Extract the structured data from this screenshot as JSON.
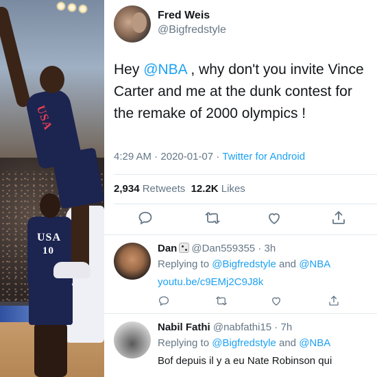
{
  "main_tweet": {
    "author_name": "Fred Weis",
    "author_handle": "@Bigfredstyle",
    "text_parts": {
      "pre": "Hey ",
      "mention": "@NBA",
      "post": " , why don't you invite Vince Carter and me at the dunk contest for the remake of 2000 olympics !"
    },
    "time": "4:29 AM",
    "separator": " · ",
    "date": "2020-01-07",
    "source": "Twitter for Android",
    "retweets_count": "2,934",
    "retweets_label": " Retweets",
    "likes_count": "12.2K",
    "likes_label": " Likes",
    "actions": [
      "reply-icon",
      "retweet-icon",
      "like-icon",
      "share-icon"
    ]
  },
  "photo": {
    "jersey_top": "USA",
    "jersey_bottom": "USA",
    "jersey_number": "10"
  },
  "replies": [
    {
      "name": "Dan",
      "emoji_icon": "dice-icon",
      "handle": "@Dan559355",
      "separator": " · ",
      "time": "3h",
      "replying_prefix": "Replying to ",
      "mention1": "@Bigfredstyle",
      "and_word": " and ",
      "mention2": "@NBA",
      "link": "youtu.be/c9EMj2C9J8k"
    },
    {
      "name": "Nabil Fathi",
      "handle": "@nabfathi15",
      "separator": " · ",
      "time": "7h",
      "replying_prefix": "Replying to ",
      "mention1": "@Bigfredstyle",
      "and_word": " and ",
      "mention2": "@NBA",
      "body": "Bof depuis il y a eu Nate Robinson qui"
    }
  ],
  "colors": {
    "accent": "#1da1f2",
    "secondary_text": "#657786",
    "primary_text": "#14171a",
    "divider": "#e1e8ed"
  }
}
